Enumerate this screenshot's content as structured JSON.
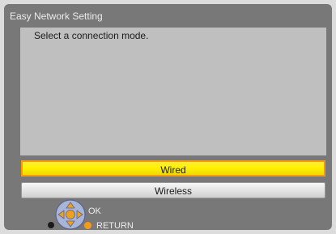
{
  "window": {
    "title": "Easy Network Setting"
  },
  "dialog": {
    "prompt": "Select a connection mode."
  },
  "options": [
    {
      "label": "Wired",
      "selected": true
    },
    {
      "label": "Wireless",
      "selected": false
    }
  ],
  "hints": {
    "ok_label": "OK",
    "return_label": "RETURN"
  },
  "colors": {
    "selection_fill": "#fff200",
    "selection_border": "#f29a12",
    "panel": "#787878",
    "content": "#bfbfbf"
  },
  "icons": {
    "dpad": "dpad-icon",
    "back_button": "black-dot-icon",
    "return_button": "orange-dot-icon"
  }
}
